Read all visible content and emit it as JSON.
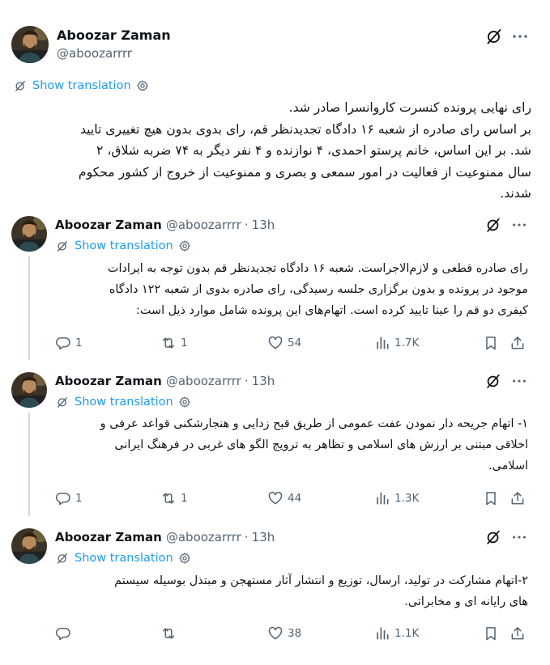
{
  "main_post": {
    "author_name": "Aboozar Zaman",
    "author_handle": "@aboozarrrr",
    "translate_label": "Show translation",
    "text_lines": [
      "رای نهایی پرونده کنسرت کاروانسرا صادر شد.",
      "بر اساس رای صادره از شعبه ۱۶ دادگاه تجدیدنظر قم، رای بدوی بدون هیچ تغییری تایید",
      "شد. بر این اساس، خانم پرستو احمدی، ۴ نوازنده و ۴ نفر دیگر به ۷۴ ضربه شلاق، ۲",
      "سال ممنوعیت از فعالیت در امور سمعی و بصری و ممنوعیت از خروج از کشور محکوم",
      "شدند."
    ]
  },
  "replies": [
    {
      "author_name": "Aboozar Zaman",
      "author_handle": "@aboozarrrr",
      "separator": "·",
      "time": "13h",
      "translate_label": "Show translation",
      "text_lines": [
        "رای صادره قطعی و لازم‌الاجراست. شعبه ۱۶ دادگاه تجدیدنظر قم بدون توجه به ایرادات",
        "موجود در پرونده و بدون برگزاری جلسه رسیدگی، رای صادره بدوی از شعبه ۱۲۲ دادگاه",
        "کیفری دو قم را عینا تایید کرده است. اتهام‌های این پرونده شامل موارد ذیل است:"
      ],
      "stats": {
        "replies": "1",
        "reposts": "1",
        "likes": "54",
        "views": "1.7K"
      }
    },
    {
      "author_name": "Aboozar Zaman",
      "author_handle": "@aboozarrrr",
      "separator": "·",
      "time": "13h",
      "translate_label": "Show translation",
      "text_lines": [
        "۱-  اتهام جریحه دار نمودن عفت عمومی از طریق قبح زدایی و هنجارشکنی قواعد عرفی و",
        "اخلاقی مبتنی بر ارزش های اسلامی و تظاهر به ترویج الگو های غربی در فرهنگ ایرانی",
        "اسلامی."
      ],
      "stats": {
        "replies": "1",
        "reposts": "1",
        "likes": "44",
        "views": "1.3K"
      }
    },
    {
      "author_name": "Aboozar Zaman",
      "author_handle": "@aboozarrrr",
      "separator": "·",
      "time": "13h",
      "translate_label": "Show translation",
      "text_lines": [
        "۲-اتهام  مشارکت در تولید، ارسال، توزیع و انتشار آثار مستهجن و مبتذل بوسیله سیستم",
        "های رایانه ای و مخابراتی."
      ],
      "stats": {
        "replies": "",
        "reposts": "",
        "likes": "38",
        "views": "1.1K"
      }
    }
  ],
  "icons": {
    "grok": "grok-icon",
    "more": "more-icon",
    "translate": "translate-icon",
    "settings": "settings-gear-icon",
    "reply": "reply-icon",
    "repost": "repost-icon",
    "like": "like-icon",
    "views": "views-icon",
    "bookmark": "bookmark-icon",
    "share": "share-icon"
  },
  "colors": {
    "link": "#1d9bf0",
    "muted": "#536471",
    "text": "#0f1419",
    "thread_line": "#cfd9de"
  }
}
